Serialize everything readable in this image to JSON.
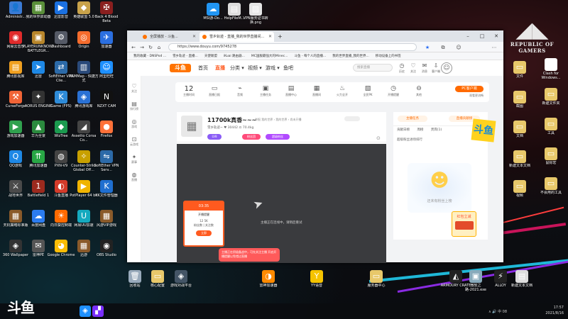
{
  "desktop": {
    "left_icons": [
      {
        "label": "Administr...",
        "color": "#3a7bd5",
        "glyph": "👤"
      },
      {
        "label": "我的世界启动器",
        "color": "#5a8f3a",
        "glyph": "▦"
      },
      {
        "label": "迅雷影音",
        "color": "#1b70e0",
        "glyph": "▶"
      },
      {
        "label": "英雄联盟 5.0",
        "color": "#c8a24a",
        "glyph": "◆"
      },
      {
        "label": "Back 4 Blood Beta",
        "color": "#8a1f1f",
        "glyph": "✠"
      },
      {
        "label": "网易云音乐",
        "color": "#e02b2b",
        "glyph": "◉"
      },
      {
        "label": "PLAYERUNKNOWN'S BATTLEGR...",
        "color": "#b8862b",
        "glyph": "▣"
      },
      {
        "label": "Dashboard",
        "color": "#555a66",
        "glyph": "⚙"
      },
      {
        "label": "Origin",
        "color": "#f56c2d",
        "glyph": "◎"
      },
      {
        "label": "加速器",
        "color": "#2b6fe0",
        "glyph": "✈"
      },
      {
        "label": "腾讯影视库",
        "color": "#f0a020",
        "glyph": "▤"
      },
      {
        "label": "迅雷",
        "color": "#1e88e5",
        "glyph": "➤"
      },
      {
        "label": "SoftEther VPN Clie...",
        "color": "#2c6aa8",
        "glyph": "⇄"
      },
      {
        "label": "RAMMap - 快捷方式",
        "color": "#2a4a7a",
        "glyph": "▥"
      },
      {
        "label": "阿里旺旺",
        "color": "#1e90ff",
        "glyph": "☺"
      },
      {
        "label": "CurseForge",
        "color": "#f16436",
        "glyph": "⚒"
      },
      {
        "label": "AORUS ENGINE",
        "color": "#333",
        "glyph": "✦"
      },
      {
        "label": "Game (FPS)",
        "color": "#2e8bd8",
        "glyph": "K"
      },
      {
        "label": "腾讯游戏库",
        "color": "#2a71d4",
        "glyph": "◈"
      },
      {
        "label": "NZXT CAM",
        "color": "#111",
        "glyph": "N"
      },
      {
        "label": "游戏加速器",
        "color": "#30a14e",
        "glyph": "▶"
      },
      {
        "label": "华为全景",
        "color": "#2b8a3e",
        "glyph": "▲"
      },
      {
        "label": "WizTree",
        "color": "#1b9a4f",
        "glyph": "◆"
      },
      {
        "label": "Assetto Corsa Co...",
        "color": "#444",
        "glyph": "◢"
      },
      {
        "label": "Firefox",
        "color": "#ff7139",
        "glyph": "●"
      },
      {
        "label": "QQ游戏",
        "color": "#1e88e5",
        "glyph": "Q"
      },
      {
        "label": "腾讯加速器",
        "color": "#28a745",
        "glyph": "⇈"
      },
      {
        "label": "PXN-V9",
        "color": "#444",
        "glyph": "◍"
      },
      {
        "label": "Counter-Strike Global Off...",
        "color": "#c8a000",
        "glyph": "✧"
      },
      {
        "label": "SoftEther VPN Serv...",
        "color": "#2c6aa8",
        "glyph": "⇋"
      },
      {
        "label": "战地世界",
        "color": "#4a4a4a",
        "glyph": "⚔"
      },
      {
        "label": "Battlefield 1",
        "color": "#9b2a1e",
        "glyph": "1"
      },
      {
        "label": "斗鱼直播",
        "color": "#d43b2a",
        "glyph": "◐"
      },
      {
        "label": "PotPlayer 64 bit",
        "color": "#f0b400",
        "glyph": "▶"
      },
      {
        "label": "KK文件管理器",
        "color": "#1f6fd0",
        "glyph": "K"
      },
      {
        "label": "天机策略标准版",
        "color": "#8a5a2a",
        "glyph": "▦"
      },
      {
        "label": "百度网盘",
        "color": "#2b7cf0",
        "glyph": "☁"
      },
      {
        "label": "向日葵控制端",
        "color": "#ff6a00",
        "glyph": "☀"
      },
      {
        "label": "网易UU加速",
        "color": "#15aabf",
        "glyph": "U"
      },
      {
        "label": "风游VIP游戏",
        "color": "#8a5a2a",
        "glyph": "▦"
      },
      {
        "label": "360 Wallpaper",
        "color": "#333",
        "glyph": "◈"
      },
      {
        "label": "雷神PE",
        "color": "#555",
        "glyph": "✉"
      },
      {
        "label": "Google Chrome",
        "color": "#fbbc05",
        "glyph": "◕"
      },
      {
        "label": "迅游",
        "color": "#8a5a2a",
        "glyph": "▦"
      },
      {
        "label": "OBS Studio",
        "color": "#222",
        "glyph": "◉"
      }
    ],
    "top_icons": [
      {
        "label": "MSI游-Do...",
        "color": "#2196f3",
        "glyph": "☁"
      },
      {
        "label": "HelpFileM...",
        "color": "#ddd",
        "glyph": "▤"
      },
      {
        "label": "VPN服务证书转换.png",
        "color": "#e6e6e6",
        "glyph": "▨"
      }
    ],
    "right_icons": [
      {
        "label": "文件",
        "color": "#e8c86a",
        "glyph": "▭"
      },
      {
        "label": "Clash for Windows...",
        "color": "#fff",
        "glyph": "◔"
      },
      {
        "label": "截图",
        "color": "#e8c86a",
        "glyph": "▭"
      },
      {
        "label": "新建文件夹",
        "color": "#e8c86a",
        "glyph": "▭"
      },
      {
        "label": "文档",
        "color": "#e8c86a",
        "glyph": "▭"
      },
      {
        "label": "工具",
        "color": "#e8c86a",
        "glyph": "▭"
      },
      {
        "label": "新建文本文档",
        "color": "#e8c86a",
        "glyph": "▭"
      },
      {
        "label": "鼠标宏",
        "color": "#e8c86a",
        "glyph": "▭"
      },
      {
        "label": "视频",
        "color": "#e8c86a",
        "glyph": "▭"
      },
      {
        "label": "不会用的工具",
        "color": "#e8c86a",
        "glyph": "▭"
      }
    ],
    "bottom_row": [
      {
        "label": "回收站",
        "color": "#9ab",
        "glyph": "🗑"
      },
      {
        "label": "核心配置",
        "color": "#e8c86a",
        "glyph": "▭"
      },
      {
        "label": "游戏对战平台",
        "color": "#456",
        "glyph": "◈"
      },
      {
        "label": "雷神加速器",
        "color": "#ff8a00",
        "glyph": "◑"
      },
      {
        "label": "YY语音",
        "color": "#f5c300",
        "glyph": "Y"
      },
      {
        "label": "服务器中心",
        "color": "#e8c86a",
        "glyph": "▭"
      },
      {
        "label": "ARMOURY CRATE",
        "color": "#222",
        "glyph": "◭"
      },
      {
        "label": "微软之路-2021.exe",
        "color": "#8ab",
        "glyph": "▣"
      },
      {
        "label": "ALLOY",
        "color": "#222",
        "glyph": "⚡"
      },
      {
        "label": "新建文本文档",
        "color": "#ddd",
        "glyph": "▤"
      }
    ],
    "rog": {
      "logo": "◢◣",
      "line1": "REPUBLIC OF",
      "line2": "GAMERS"
    }
  },
  "browser": {
    "tabs": [
      {
        "label": "全屏播放 - 斗鱼...",
        "active": false
      },
      {
        "label": "雪乡轨迹 - 直播_我的世界直播间...",
        "active": true
      }
    ],
    "new_tab": "+",
    "window_controls": {
      "min": "–",
      "max": "□",
      "close": "✕"
    },
    "url": "https://www.douyu.com/9745278",
    "bookmarks": [
      "我的收藏 - DNSPod ...",
      "雪乡轨迹 - 直播...",
      "天使联盟",
      "iKuai 路由器...",
      "MC国服最强大的Minec...",
      "斗鱼 - 每个人的直播...",
      "我的世界直播_我的世界...",
      "移动设备上的书签"
    ],
    "site": {
      "logo": "斗鱼",
      "nav": [
        {
          "label": "首页",
          "active": false
        },
        {
          "label": "直播",
          "active": true
        },
        {
          "label": "分类 ▾",
          "active": false
        },
        {
          "label": "视频 ▾",
          "active": false
        },
        {
          "label": "游戏 ▾",
          "active": false
        },
        {
          "label": "鱼吧",
          "active": false
        }
      ],
      "search_placeholder": "搜索直播",
      "header_icons": [
        {
          "glyph": "◷",
          "label": "历史"
        },
        {
          "glyph": "♡",
          "label": "关注"
        },
        {
          "glyph": "✉",
          "label": "消息"
        },
        {
          "glyph": "⇩",
          "label": "客户端"
        }
      ],
      "left_rail": [
        {
          "glyph": "♡",
          "label": "关注"
        },
        {
          "glyph": "▤",
          "label": "排行榜"
        },
        {
          "glyph": "◎",
          "label": "游戏"
        },
        {
          "glyph": "⊡",
          "label": "云游戏"
        },
        {
          "glyph": "✦",
          "label": "赛事"
        },
        {
          "glyph": "◍",
          "label": "直播"
        }
      ],
      "toolbar": [
        {
          "value": "12",
          "label": "主播时间"
        },
        {
          "glyph": "▭",
          "label": "直播日报"
        },
        {
          "glyph": "⌁",
          "label": "音频"
        },
        {
          "glyph": "▣",
          "label": "主播任务"
        },
        {
          "glyph": "▤",
          "label": "直播中心"
        },
        {
          "glyph": "▦",
          "label": "直播间"
        },
        {
          "glyph": "♨",
          "label": "火力全开"
        },
        {
          "glyph": "▧",
          "label": "全民PK"
        },
        {
          "glyph": "◷",
          "label": "开播提醒"
        },
        {
          "glyph": "⊖",
          "label": "其他"
        }
      ],
      "pc_button": "PC客户端",
      "pc_sub": "观看更流畅",
      "room": {
        "avatar": "▦",
        "title": "11700k真香~~~",
        "meta": "举报  我的世界 › 我的世界 › 尚未开播",
        "stats": "雪乡轨迹~   ♥ 30442   ⚖ 70.4kg",
        "badge_level": "LV8",
        "tag1": "粉丝团",
        "tag2": "超级粉丝"
      },
      "video_status": "主播正在连线中，请稍后重试",
      "popup": {
        "header": "03:35",
        "text": "开播提醒",
        "stats": "12   5K",
        "stats_label": "粉丝数  | 关注数",
        "button": "立即"
      },
      "toast": "主播正在积极备战中，可先关注主播 开启开播提醒以免错过直播",
      "chat": {
        "tabs": [
          "主播任务",
          "直播贡献榜"
        ],
        "sub": [
          "贡献日榜",
          "周榜",
          "贵宾(1)"
        ],
        "list_title": "超级粉丝进场排行",
        "doll_caption": "还未有粉丝上榜"
      },
      "sticker1": "斗鱼",
      "sticker2": "红包立减"
    }
  },
  "taskbar": {
    "brand": "斗鱼",
    "icons": [
      {
        "color": "#1e90ff",
        "glyph": "◈"
      },
      {
        "color": "#7a2fff",
        "glyph": "▞"
      }
    ],
    "tray": "∧  🔊  中  08",
    "clock_time": "17:57",
    "clock_date": "2021/8/16"
  }
}
